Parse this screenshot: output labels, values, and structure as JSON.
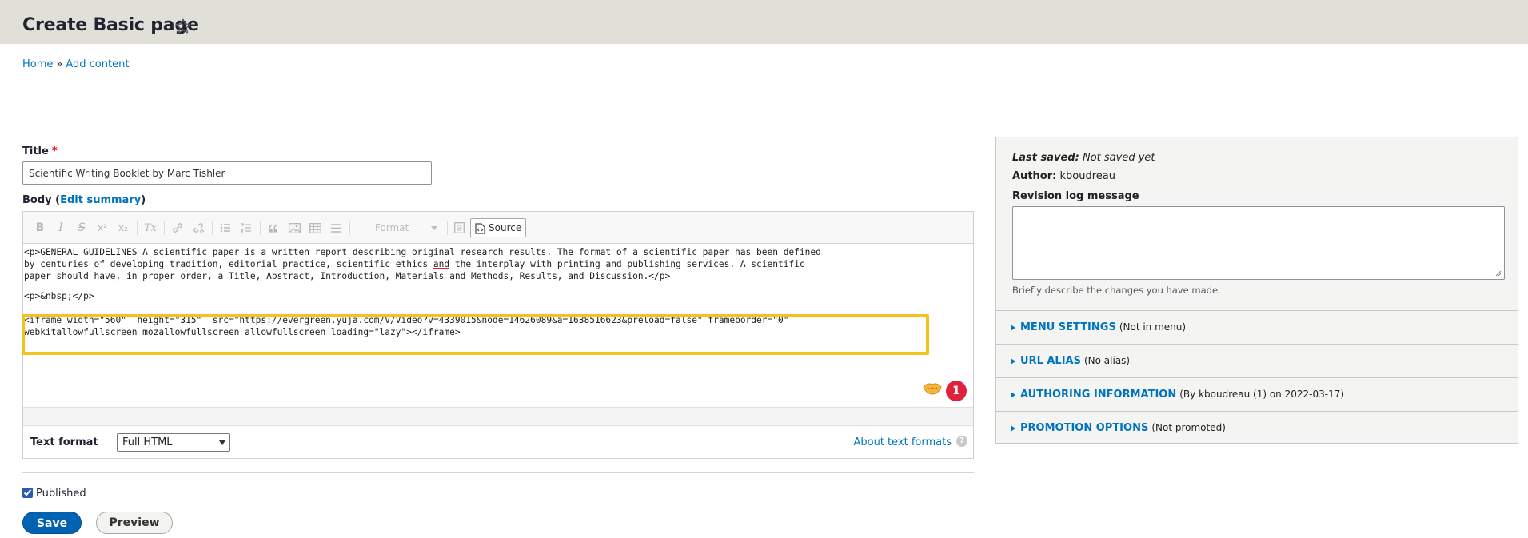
{
  "page": {
    "title": "Create Basic page"
  },
  "breadcrumb": {
    "home": "Home",
    "separator": "»",
    "add_content": "Add content"
  },
  "form": {
    "title_label": "Title",
    "title_required": "*",
    "title_value": "Scientific Writing Booklet by Marc Tishler",
    "body_label": "Body (",
    "edit_summary": "Edit summary",
    "body_label_end": ")"
  },
  "editor": {
    "toolbar": {
      "bold": "B",
      "italic": "I",
      "strike": "S",
      "superscript": "x²",
      "subscript": "x₂",
      "remove_format": "Tx",
      "format_label": "Format",
      "source_label": "Source"
    },
    "code_lines": [
      "<p>GENERAL GUIDELINES A scientific paper is a written report describing original research results. The format of a scientific paper has been defined",
      "by centuries of developing tradition, editorial practice, scientific ethics ",
      "and",
      " the interplay with printing and publishing services. A scientific",
      "paper should have, in proper order, a Title, Abstract, Introduction, Materials and Methods, Results, and Discussion.</p>",
      "<p>&nbsp;</p>",
      "<iframe width=\"560\"  height=\"315\"  src=\"https://evergreen.yuja.com/V/Video?v=4339015&node=14626089&a=1638516623&preload=false\" frameborder=\"0\"",
      "webkitallowfullscreen mozallowfullscreen allowfullscreen loading=\"lazy\"></iframe>"
    ],
    "badge_count": "1"
  },
  "text_format": {
    "label": "Text format",
    "selected": "Full HTML",
    "about_link": "About text formats",
    "help": "?"
  },
  "published": {
    "label": "Published",
    "checked": true
  },
  "actions": {
    "save": "Save",
    "preview": "Preview"
  },
  "sidebar": {
    "last_saved_label": "Last saved:",
    "last_saved_value": "Not saved yet",
    "author_label": "Author:",
    "author_value": "kboudreau",
    "revision_label": "Revision log message",
    "revision_help": "Briefly describe the changes you have made.",
    "sections": [
      {
        "title": "MENU SETTINGS",
        "summary": "(Not in menu)"
      },
      {
        "title": "URL ALIAS",
        "summary": "(No alias)"
      },
      {
        "title": "AUTHORING INFORMATION",
        "summary": "(By kboudreau (1) on 2022-03-17)"
      },
      {
        "title": "PROMOTION OPTIONS",
        "summary": "(Not promoted)"
      }
    ]
  },
  "colors": {
    "link": "#0074bd",
    "header_bg": "#e0e0d8",
    "highlight": "#f2c41b",
    "badge": "#e0213b",
    "save_bg": "#0062b0"
  }
}
